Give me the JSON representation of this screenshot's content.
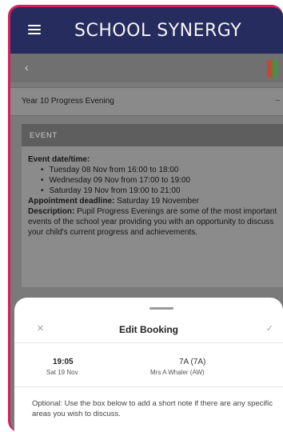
{
  "app": {
    "brand": "SCHOOL SYNERGY"
  },
  "nav": {
    "title": ""
  },
  "select": {
    "value": "Year 10 Progress Evening"
  },
  "section": {
    "label": "EVENT"
  },
  "event": {
    "date_time_label": "Event date/time:",
    "sessions": [
      "Tuesday 08 Nov from 16:00 to 18:00",
      "Wednesday 09 Nov from 17:00 to 19:00",
      "Saturday 19 Nov from 19:00 to 21:00"
    ],
    "deadline_label": "Appointment deadline:",
    "deadline_value": "Saturday 19 November",
    "description_label": "Description:",
    "description_value": "Pupil Progress Evenings are some of the most important events of the school year providing you with an opportunity to discuss your child's current progress and achievements."
  },
  "sheet": {
    "title": "Edit Booking",
    "time": "19:05",
    "date": "Sat 19 Nov",
    "room": "7A (7A)",
    "teacher": "Mrs A Whaler (AW)",
    "note": "Optional: Use the box below to add a short note if there are any specific areas you wish to discuss."
  },
  "icons": {
    "menu": "hamburger-icon",
    "back": "back-arrow-icon",
    "caret": "chevron-down-icon",
    "close": "close-icon",
    "confirm": "check-icon"
  },
  "colors": {
    "header": "#262c5e",
    "accent": "#d61f5a"
  }
}
